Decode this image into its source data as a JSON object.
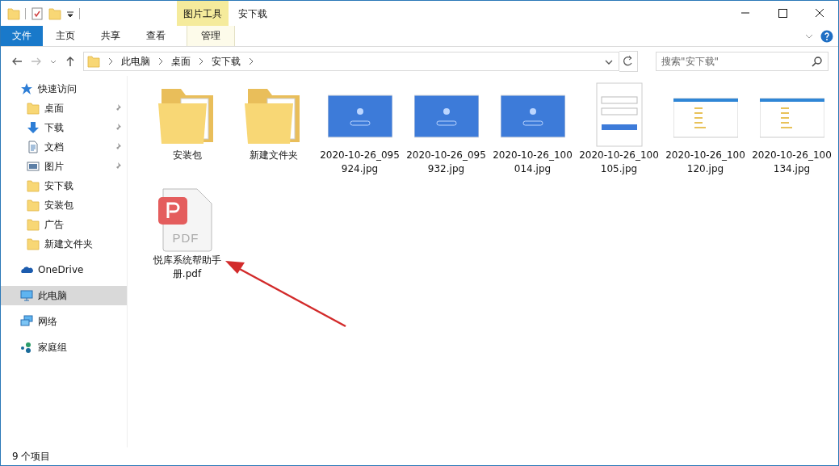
{
  "window": {
    "title": "安下载",
    "context_label": "图片工具"
  },
  "ribbon_tabs": [
    {
      "label": "文件",
      "kind": "file",
      "selected": false
    },
    {
      "label": "主页",
      "kind": "plain",
      "selected": false
    },
    {
      "label": "共享",
      "kind": "plain",
      "selected": false
    },
    {
      "label": "查看",
      "kind": "plain",
      "selected": false
    },
    {
      "label": "管理",
      "kind": "context",
      "selected": false
    }
  ],
  "address_bar": {
    "path": [
      "此电脑",
      "桌面",
      "安下载"
    ]
  },
  "search": {
    "placeholder": "搜索\"安下载\""
  },
  "sidebar": {
    "items": [
      {
        "label": "快速访问",
        "kind": "star",
        "selected": false,
        "children": [
          {
            "label": "桌面",
            "kind": "folder",
            "pinned": true,
            "selected": false
          },
          {
            "label": "下载",
            "kind": "download",
            "pinned": true,
            "selected": false
          },
          {
            "label": "文档",
            "kind": "document",
            "pinned": true,
            "selected": false
          },
          {
            "label": "图片",
            "kind": "pictures",
            "pinned": true,
            "selected": false
          },
          {
            "label": "安下载",
            "kind": "folder",
            "pinned": false,
            "selected": false
          },
          {
            "label": "安装包",
            "kind": "folder",
            "pinned": false,
            "selected": false
          },
          {
            "label": "广告",
            "kind": "folder",
            "pinned": false,
            "selected": false
          },
          {
            "label": "新建文件夹",
            "kind": "folder",
            "pinned": false,
            "selected": false
          }
        ]
      },
      {
        "label": "OneDrive",
        "kind": "cloud",
        "selected": false
      },
      {
        "label": "此电脑",
        "kind": "computer",
        "selected": true
      },
      {
        "label": "网络",
        "kind": "network",
        "selected": false
      },
      {
        "label": "家庭组",
        "kind": "homegroup",
        "selected": false
      }
    ]
  },
  "files": [
    {
      "name": "安装包",
      "kind": "folder"
    },
    {
      "name": "新建文件夹",
      "kind": "folder"
    },
    {
      "name": "2020-10-26_095924.jpg",
      "kind": "bluescreen"
    },
    {
      "name": "2020-10-26_095932.jpg",
      "kind": "bluescreen"
    },
    {
      "name": "2020-10-26_100014.jpg",
      "kind": "bluescreen"
    },
    {
      "name": "2020-10-26_100105.jpg",
      "kind": "loginpage"
    },
    {
      "name": "2020-10-26_100120.jpg",
      "kind": "appwindow"
    },
    {
      "name": "2020-10-26_100134.jpg",
      "kind": "appwindow"
    },
    {
      "name": "悦库系统帮助手册.pdf",
      "kind": "pdf",
      "icon_text": "PDF"
    }
  ],
  "status_bar": {
    "count": "9 个项目"
  }
}
